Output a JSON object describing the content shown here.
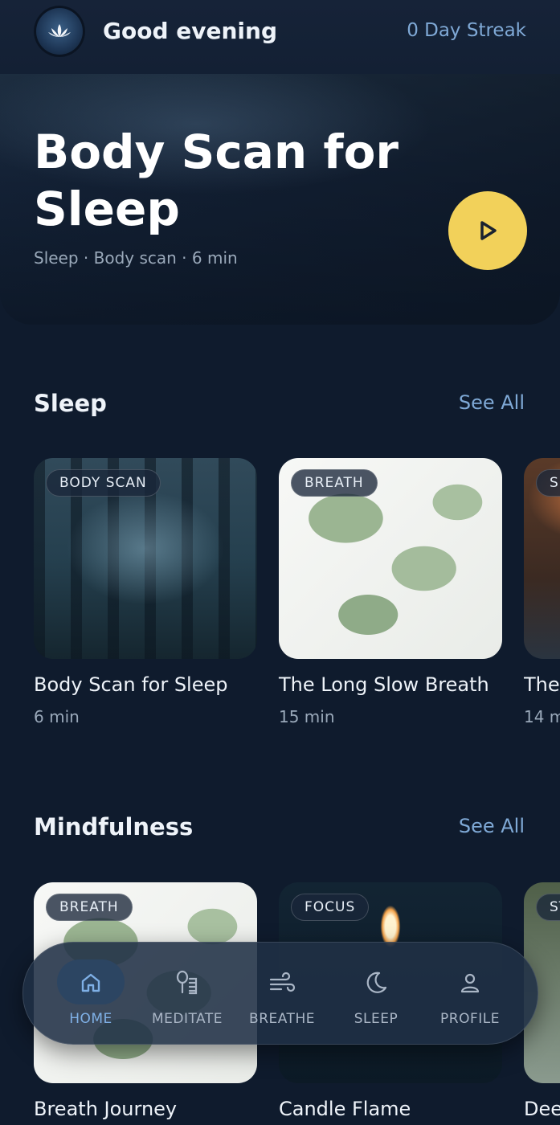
{
  "header": {
    "greeting": "Good evening",
    "streak": "0 Day Streak",
    "logo_icon": "lotus-icon"
  },
  "hero": {
    "title": "Body Scan for Sleep",
    "meta": "Sleep · Body scan · 6 min",
    "play_icon": "play-icon"
  },
  "sections": [
    {
      "title": "Sleep",
      "see_all": "See All",
      "cards": [
        {
          "tag": "BODY SCAN",
          "title": "Body Scan for Sleep",
          "duration": "6 min"
        },
        {
          "tag": "BREATH",
          "title": "The Long Slow Breath",
          "duration": "15 min"
        },
        {
          "tag": "SL",
          "title": "The",
          "duration": "14 m"
        }
      ]
    },
    {
      "title": "Mindfulness",
      "see_all": "See All",
      "cards": [
        {
          "tag": "BREATH",
          "title": "Breath Journey",
          "duration": ""
        },
        {
          "tag": "FOCUS",
          "title": "Candle Flame",
          "duration": ""
        },
        {
          "tag": "ST",
          "title": "Dee",
          "duration": ""
        }
      ]
    }
  ],
  "nav": [
    {
      "label": "HOME",
      "icon": "home-icon",
      "active": true
    },
    {
      "label": "MEDITATE",
      "icon": "meditate-icon",
      "active": false
    },
    {
      "label": "BREATHE",
      "icon": "wind-icon",
      "active": false
    },
    {
      "label": "SLEEP",
      "icon": "moon-icon",
      "active": false
    },
    {
      "label": "PROFILE",
      "icon": "user-icon",
      "active": false
    }
  ],
  "colors": {
    "background": "#0f1b2d",
    "accent": "#7fa9d6",
    "play_button": "#f2d15a"
  }
}
